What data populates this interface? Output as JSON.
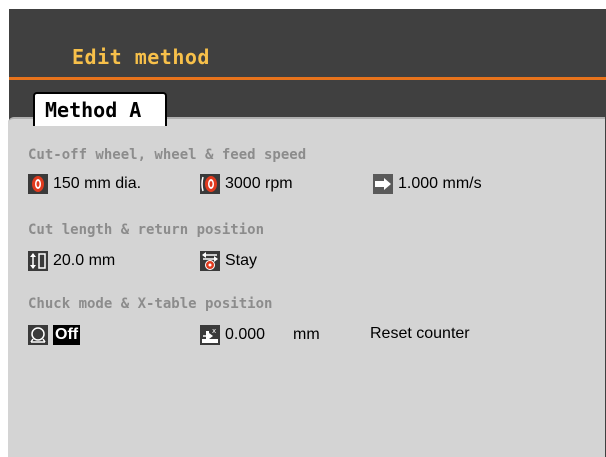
{
  "header": {
    "title": "Edit method"
  },
  "tab": {
    "label": "Method A"
  },
  "sections": {
    "wheel_speed": {
      "heading": "Cut-off wheel, wheel & feed speed",
      "wheel_diameter": {
        "icon": "cutoff-wheel-icon",
        "value": "150 mm dia."
      },
      "wheel_speed": {
        "icon": "wheel-speed-icon",
        "value": "3000 rpm"
      },
      "feed_speed": {
        "icon": "feed-speed-icon",
        "value": "1.000 mm/s"
      }
    },
    "cut_length": {
      "heading": "Cut length & return position",
      "length": {
        "icon": "cut-length-icon",
        "value": "20.0 mm"
      },
      "return_position": {
        "icon": "return-position-icon",
        "value": "Stay"
      }
    },
    "chuck": {
      "heading": "Chuck mode & X-table position",
      "chuck_mode": {
        "icon": "chuck-mode-icon",
        "value": "Off"
      },
      "x_table": {
        "icon": "x-table-icon",
        "value": "0.000",
        "unit": "mm"
      },
      "reset_label": "Reset counter"
    }
  },
  "colors": {
    "title": "#f7c04a",
    "accent_line": "#e8731c",
    "background": "#404040",
    "panel": "#d4d4d4",
    "heading": "#8c8c8c",
    "icon_red": "#e03a1e"
  }
}
